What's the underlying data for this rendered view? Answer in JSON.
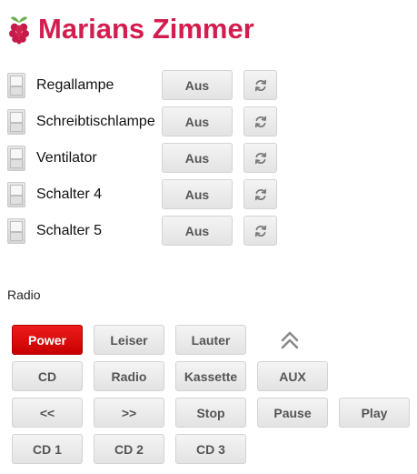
{
  "header": {
    "title": "Marians Zimmer",
    "logo_icon": "raspberry-pi-logo-icon",
    "title_color": "#d21d4e"
  },
  "switches": [
    {
      "label": "Regallampe",
      "state_label": "Aus"
    },
    {
      "label": "Schreibtischlampe",
      "state_label": "Aus"
    },
    {
      "label": "Ventilator",
      "state_label": "Aus"
    },
    {
      "label": "Schalter 4",
      "state_label": "Aus"
    },
    {
      "label": "Schalter 5",
      "state_label": "Aus"
    }
  ],
  "refresh_icon": "refresh-icon",
  "radio": {
    "section_label": "Radio",
    "row1": {
      "power": "Power",
      "leiser": "Leiser",
      "lauter": "Lauter"
    },
    "row2": {
      "cd": "CD",
      "radio": "Radio",
      "kassette": "Kassette",
      "aux": "AUX"
    },
    "row3": {
      "rewind": "<<",
      "forward": ">>",
      "stop": "Stop",
      "pause": "Pause",
      "play": "Play"
    },
    "row4": {
      "cd1": "CD 1",
      "cd2": "CD 2",
      "cd3": "CD 3"
    },
    "power_color": "#e01010",
    "collapse_icon": "double-chevron-up-icon"
  }
}
